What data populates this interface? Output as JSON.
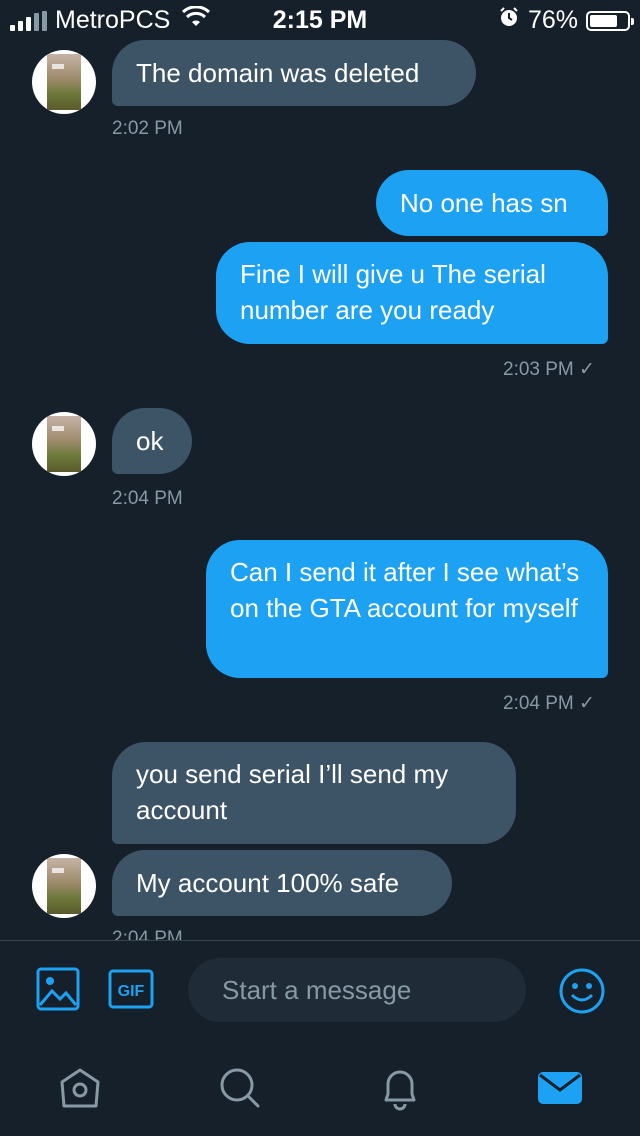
{
  "status_bar": {
    "carrier": "MetroPCS",
    "time": "2:15 PM",
    "battery_percent": "76%",
    "battery_level": 0.76,
    "icons": [
      "signal-icon",
      "wifi-icon",
      "alarm-icon",
      "battery-icon"
    ]
  },
  "messages": [
    {
      "direction": "in",
      "text": "The domain was deleted"
    },
    {
      "direction": "in",
      "time": "2:02 PM"
    },
    {
      "direction": "out",
      "text": "No one has sn"
    },
    {
      "direction": "out",
      "text": "Fine I will give u The serial number are you ready"
    },
    {
      "direction": "out",
      "time": "2:03 PM",
      "check": "✓"
    },
    {
      "direction": "in",
      "text": "ok"
    },
    {
      "direction": "in",
      "time": "2:04 PM"
    },
    {
      "direction": "out",
      "text": "Can I send it after I see what’s on the GTA account for myself"
    },
    {
      "direction": "out",
      "time": "2:04 PM",
      "check": "✓"
    },
    {
      "direction": "in",
      "text": "you send serial I’ll send my account"
    },
    {
      "direction": "in",
      "text": "My account 100% safe"
    },
    {
      "direction": "in",
      "time": "2:04 PM"
    }
  ],
  "composer": {
    "placeholder": "Start a message",
    "gif_label": "GIF",
    "icons": [
      "image-icon",
      "gif-icon",
      "emoji-icon"
    ]
  },
  "tab_bar": {
    "tabs": [
      "home-icon",
      "search-icon",
      "notifications-icon",
      "messages-icon"
    ],
    "active": "messages-icon"
  },
  "colors": {
    "background": "#15202b",
    "incoming_bubble": "#3d5466",
    "outgoing_bubble": "#1da1f2",
    "accent": "#1da1f2",
    "muted_text": "#8899a6"
  }
}
